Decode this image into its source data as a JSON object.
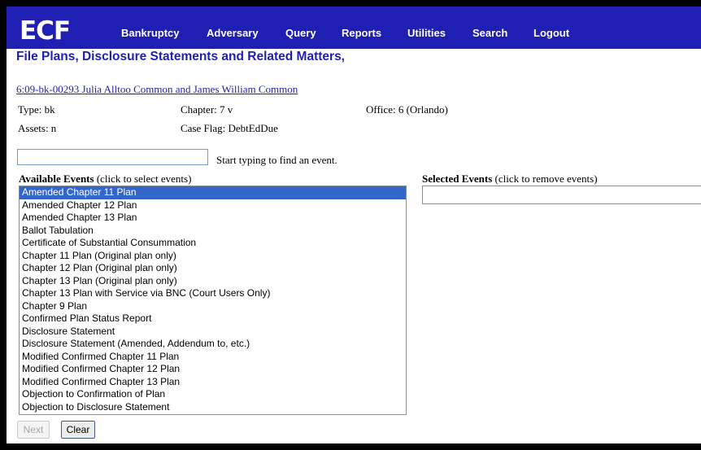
{
  "nav": {
    "logo": "ECF",
    "items": [
      "Bankruptcy",
      "Adversary",
      "Query",
      "Reports",
      "Utilities",
      "Search",
      "Logout"
    ],
    "bg_color": "#1f1fb4"
  },
  "page": {
    "title": "File Plans, Disclosure Statements and Related Matters,"
  },
  "case": {
    "link": "6:09-bk-00293 Julia Alltoo Common and James William Common",
    "type": "Type: bk",
    "chapter": "Chapter: 7 v",
    "office": "Office: 6 (Orlando)",
    "assets": "Assets: n",
    "case_flag": "Case Flag: DebtEdDue"
  },
  "search": {
    "value": "",
    "hint": "Start typing to find an event."
  },
  "available": {
    "label": "Available Events",
    "hint": " (click to select events)",
    "options": [
      "Amended Chapter 11 Plan",
      "Amended Chapter 12 Plan",
      "Amended Chapter 13 Plan",
      "Ballot Tabulation",
      "Certificate of Substantial Consummation",
      "Chapter 11 Plan (Original plan only)",
      "Chapter 12 Plan (Original plan only)",
      "Chapter 13 Plan (Original plan only)",
      "Chapter 13 Plan with Service via BNC (Court Users Only)",
      "Chapter 9 Plan",
      "Confirmed Plan Status Report",
      "Disclosure Statement",
      "Disclosure Statement (Amended, Addendum to, etc.)",
      "Modified Confirmed Chapter 11 Plan",
      "Modified Confirmed Chapter 12 Plan",
      "Modified Confirmed Chapter 13 Plan",
      "Objection to Confirmation of Plan",
      "Objection to Disclosure Statement"
    ],
    "selected_option": "Amended Chapter 11 Plan"
  },
  "selected": {
    "label": "Selected Events",
    "hint": " (click to remove events)",
    "options": []
  },
  "buttons": {
    "next": "Next",
    "clear": "Clear"
  }
}
